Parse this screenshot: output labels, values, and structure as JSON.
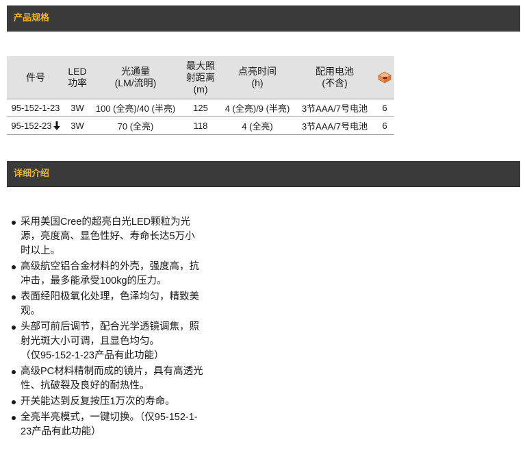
{
  "sections": {
    "specs_title": "产品规格",
    "intro_title": "详细介绍"
  },
  "spec_table": {
    "headers": [
      [
        "件号"
      ],
      [
        "LED",
        "功率"
      ],
      [
        "光通量",
        "(LM/流明)"
      ],
      [
        "最大照",
        "射距离",
        "(m)"
      ],
      [
        "点亮时间",
        "(h)"
      ],
      [
        "配用电池",
        "(不含)"
      ],
      []
    ],
    "header_last_icon": "package-box-icon",
    "rows": [
      {
        "code": "95-152-1-23",
        "new_icon": "",
        "power": "3W",
        "lumen": "100 (全亮)/40 (半亮)",
        "distance": "125",
        "runtime": "4 (全亮)/9 (半亮)",
        "battery": "3节AAA/7号电池",
        "qty": "6"
      },
      {
        "code": "95-152-23",
        "new_icon": "down-arrow-icon",
        "power": "3W",
        "lumen": "70 (全亮)",
        "distance": "118",
        "runtime": "4 (全亮)",
        "battery": "3节AAA/7号电池",
        "qty": "6"
      }
    ]
  },
  "features": [
    {
      "text": "采用美国Cree的超亮白光LED颗粒为光源，亮度高、显色性好、寿命长达5万小时以上。",
      "note": ""
    },
    {
      "text": "高级航空铝合金材料的外壳，强度高，抗冲击，最多能承受100kg的压力。",
      "note": ""
    },
    {
      "text": "表面经阳极氧化处理，色泽均匀，精致美观。",
      "note": ""
    },
    {
      "text": "头部可前后调节，配合光学透镜调焦，照射光斑大小可调，且显色均匀。",
      "note": "（仅95-152-1-23产品有此功能）"
    },
    {
      "text": "高级PC材料精制而成的镜片，具有高透光性、抗破裂及良好的耐热性。",
      "note": ""
    },
    {
      "text": "开关能达到反复按压1万次的寿命。",
      "note": ""
    },
    {
      "text": "全亮半亮模式，一键切换。（仅95-152-1-23产品有此功能）",
      "note": ""
    }
  ],
  "colors": {
    "bar_bg": "#3a3a3a",
    "bar_text": "#f2b233",
    "table_header_bg": "#e2e2e2"
  }
}
